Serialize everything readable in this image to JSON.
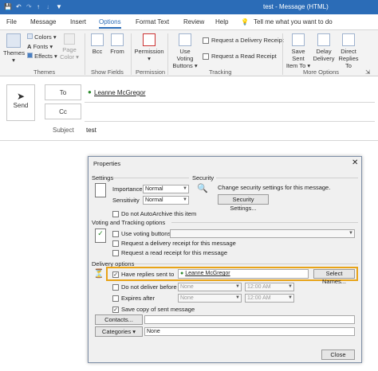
{
  "window": {
    "title": "test  -  Message (HTML)",
    "search": "Tell me what you want to do"
  },
  "tabs": [
    "File",
    "Message",
    "Insert",
    "Options",
    "Format Text",
    "Review",
    "Help"
  ],
  "ribbon": {
    "themes": {
      "themes": "Themes",
      "colors": "Colors",
      "fonts": "Fonts",
      "effects": "Effects",
      "page_color": "Page Color",
      "group": "Themes"
    },
    "show_fields": {
      "bcc": "Bcc",
      "from": "From",
      "group": "Show Fields"
    },
    "permission": {
      "label": "Permission",
      "group": "Permission"
    },
    "tracking": {
      "voting": "Use Voting Buttons",
      "delivery": "Request a Delivery Receipt",
      "read": "Request a Read Receipt",
      "group": "Tracking"
    },
    "more_options": {
      "save_sent": "Save Sent Item To",
      "delay": "Delay Delivery",
      "direct": "Direct Replies To",
      "group": "More Options"
    }
  },
  "compose": {
    "send": "Send",
    "to_button": "To",
    "to_value": "Leanne McGregor",
    "cc_button": "Cc",
    "subject_label": "Subject",
    "subject_value": "test"
  },
  "dialog": {
    "title": "Properties",
    "settings_heading": "Settings",
    "importance_label": "Importance",
    "importance_value": "Normal",
    "sensitivity_label": "Sensitivity",
    "sensitivity_value": "Normal",
    "no_autoarchive": "Do not AutoArchive this item",
    "security_heading": "Security",
    "security_text": "Change security settings for this message.",
    "security_button": "Security Settings...",
    "voting_heading": "Voting and Tracking options",
    "use_voting": "Use voting buttons",
    "req_delivery": "Request a delivery receipt for this message",
    "req_read": "Request a read receipt for this message",
    "delivery_heading": "Delivery options",
    "have_replies": "Have replies sent to",
    "replies_value": "Leanne McGregor",
    "select_names": "Select Names...",
    "no_deliver_before": "Do not deliver before",
    "none1": "None",
    "time1": "12:00 AM",
    "expires_after": "Expires after",
    "none2": "None",
    "time2": "12:00 AM",
    "save_copy": "Save copy of sent message",
    "contacts_button": "Contacts...",
    "categories_button": "Categories",
    "categories_value": "None",
    "close_button": "Close"
  }
}
